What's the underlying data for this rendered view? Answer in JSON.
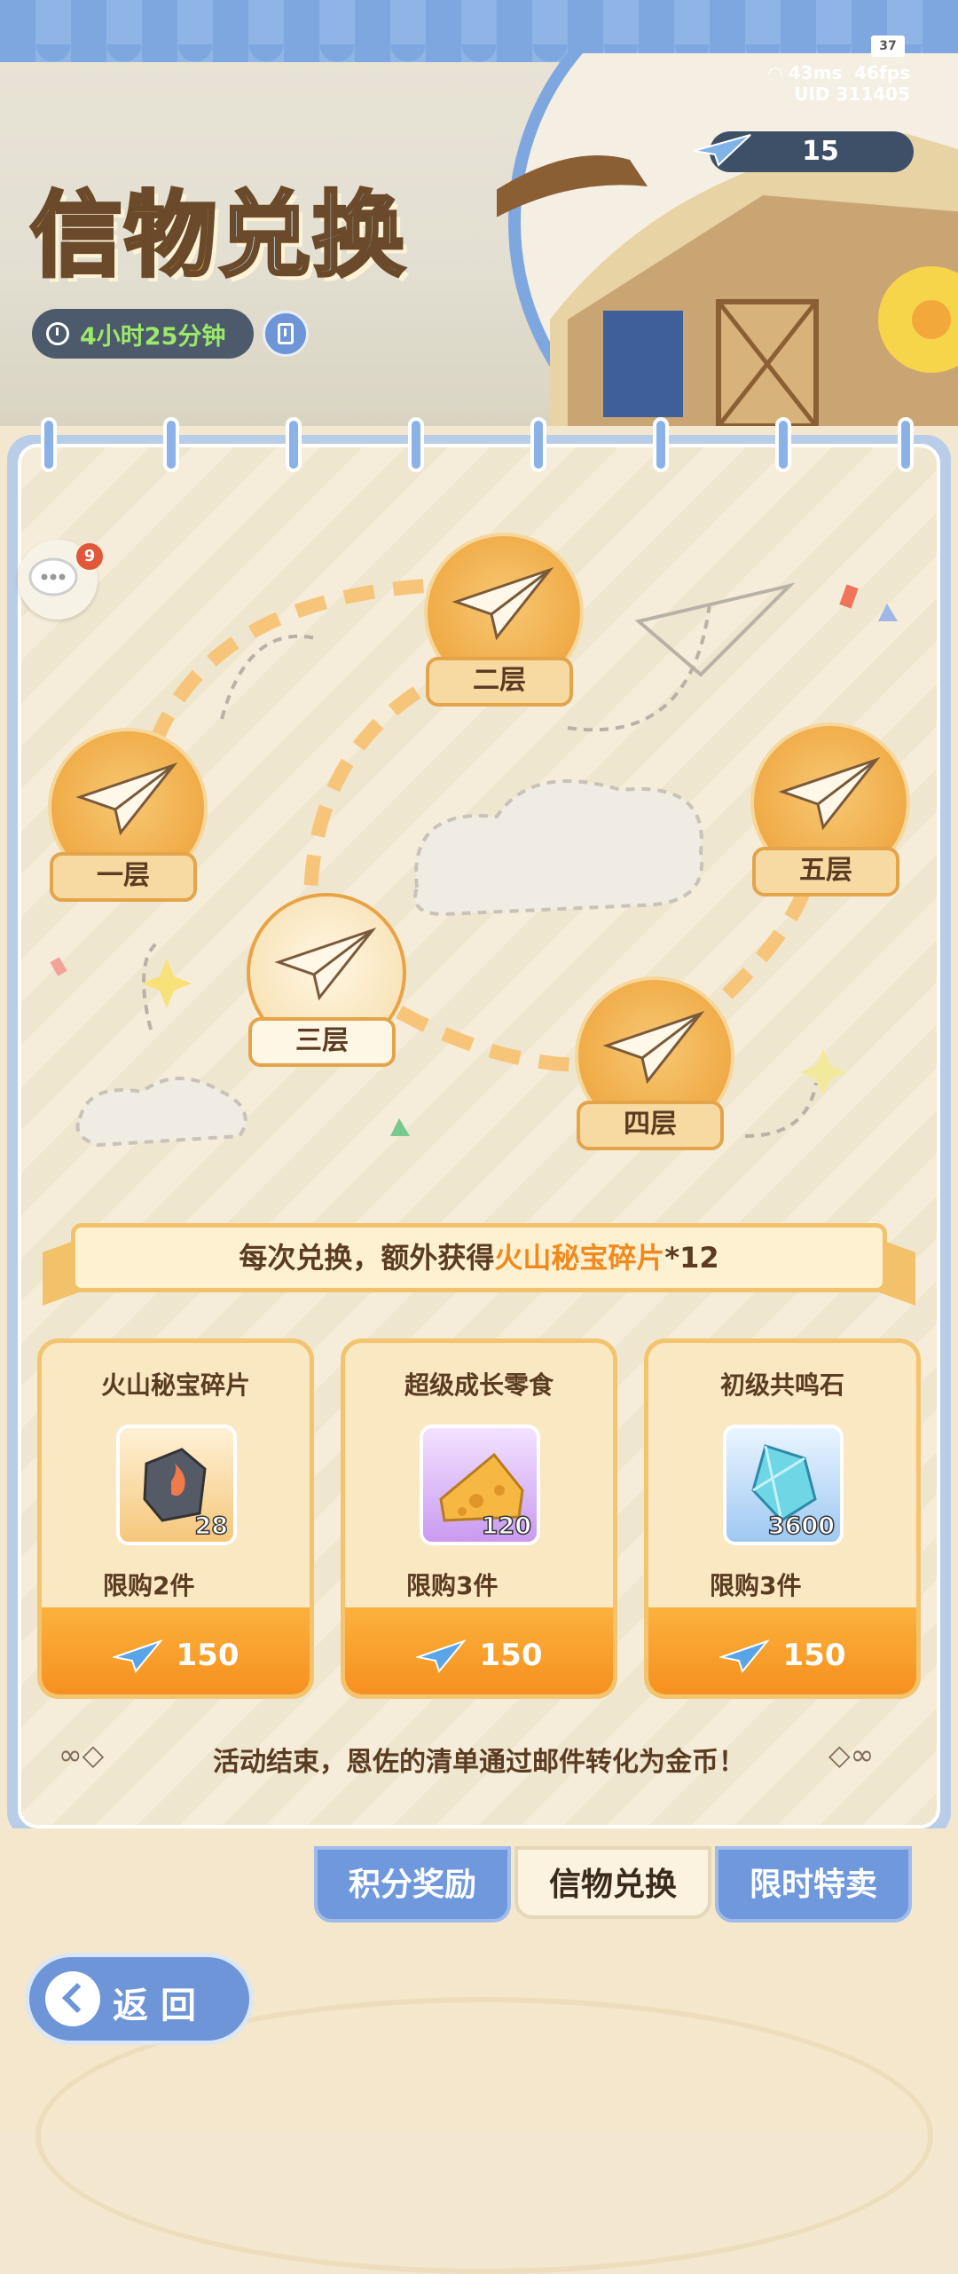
{
  "header": {
    "title_part1": "信物",
    "title_part2": "兑换",
    "timer": "4小时25分钟",
    "status": {
      "battery": "37",
      "ping": "43ms",
      "fps": "46fps",
      "uid": "UID 311405"
    },
    "token_count": "15"
  },
  "chat": {
    "badge": "9"
  },
  "floors": [
    {
      "label": "一层",
      "state": "normal"
    },
    {
      "label": "二层",
      "state": "normal"
    },
    {
      "label": "三层",
      "state": "active"
    },
    {
      "label": "四层",
      "state": "normal"
    },
    {
      "label": "五层",
      "state": "normal"
    }
  ],
  "banner": {
    "prefix": "每次兑换，额外获得",
    "highlight": "火山秘宝碎片",
    "suffix": "*12"
  },
  "cards": [
    {
      "name": "火山秘宝碎片",
      "qty": "28",
      "limit": "限购2件",
      "price": "150",
      "icon": "volcano-fragment-icon"
    },
    {
      "name": "超级成长零食",
      "qty": "120",
      "limit": "限购3件",
      "price": "150",
      "icon": "cheese-snack-icon"
    },
    {
      "name": "初级共鸣石",
      "qty": "3600",
      "limit": "限购3件",
      "price": "150",
      "icon": "resonance-crystal-icon"
    }
  ],
  "notice": "活动结束，恩佐的清单通过邮件转化为金币！",
  "tabs": [
    {
      "label": "积分奖励",
      "active": false
    },
    {
      "label": "信物兑换",
      "active": true
    },
    {
      "label": "限时特卖",
      "active": false
    }
  ],
  "back_label": "返回",
  "colors": {
    "accent_orange": "#f58d1c",
    "tab_blue": "#6f98dd",
    "highlight": "#f08a1e"
  }
}
